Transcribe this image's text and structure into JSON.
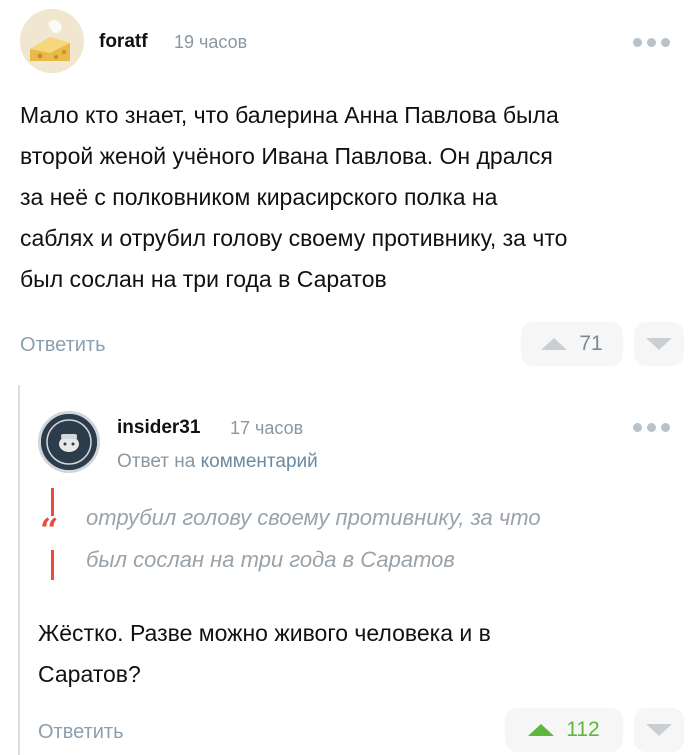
{
  "comment1": {
    "username": "foratf",
    "time": "19 часов",
    "avatar_icon": "cheese-avatar",
    "lines": [
      "Мало кто знает, что балерина Анна Павлова была",
      "второй женой учёного Ивана Павлова. Он дрался",
      "за неё с полковником кирасирского полка на",
      "саблях и отрубил голову своему противнику, за что",
      "был сослан на три года в Саратов"
    ],
    "reply_label": "Ответить",
    "votes": "71"
  },
  "comment2": {
    "username": "insider31",
    "time": "17 часов",
    "avatar_icon": "badge-avatar",
    "reply_prefix": "Ответ на",
    "reply_link": "комментарий",
    "quote_lines": [
      "отрубил голову своему противнику, за что",
      "был сослан на три года в Саратов"
    ],
    "lines": [
      "Жёстко. Разве можно живого человека и в",
      "Саратов?"
    ],
    "reply_label": "Ответить",
    "votes": "112"
  },
  "colors": {
    "accent_green": "#5fb63d",
    "quote_red": "#e94b3c",
    "muted": "#8b97a0"
  }
}
